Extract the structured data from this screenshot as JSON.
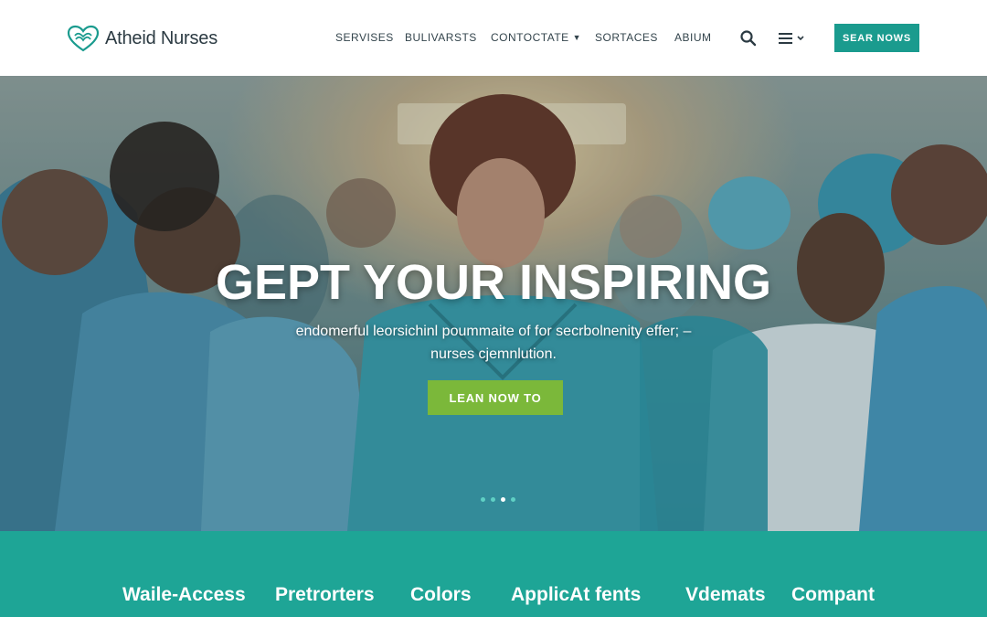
{
  "brand": {
    "name": "Atheid Nurses"
  },
  "nav": {
    "items": [
      {
        "label": "SERVISES"
      },
      {
        "label": "BULIVARSTS"
      },
      {
        "label": "CONTOCTATE"
      },
      {
        "label": "SORTACES"
      },
      {
        "label": "ABIUM"
      }
    ],
    "cta_label": "SEAR NOWS"
  },
  "hero": {
    "title": "GEPT YOUR INSPIRING",
    "subtitle_line1": "endomerful leorsichinl poummaite of for secrbolnenity effer; –",
    "subtitle_line2": "nurses cjemnlution.",
    "button_label": "LEAN NOW TO",
    "slides": 4,
    "active_slide": 3
  },
  "band": {
    "items": [
      {
        "label": "Waile-Access"
      },
      {
        "label": "Pretrorters"
      },
      {
        "label": "Colors"
      },
      {
        "label": "ApplicAt fents"
      },
      {
        "label": "Vdemats"
      },
      {
        "label": "Compant"
      }
    ]
  },
  "colors": {
    "accent": "#1a9b8e",
    "band": "#1ea596",
    "hero_button": "#7bb83a",
    "text_dark": "#2b3a42"
  },
  "icons": [
    "heart-logo-icon",
    "chevron-down-icon",
    "search-icon",
    "menu-icon"
  ]
}
